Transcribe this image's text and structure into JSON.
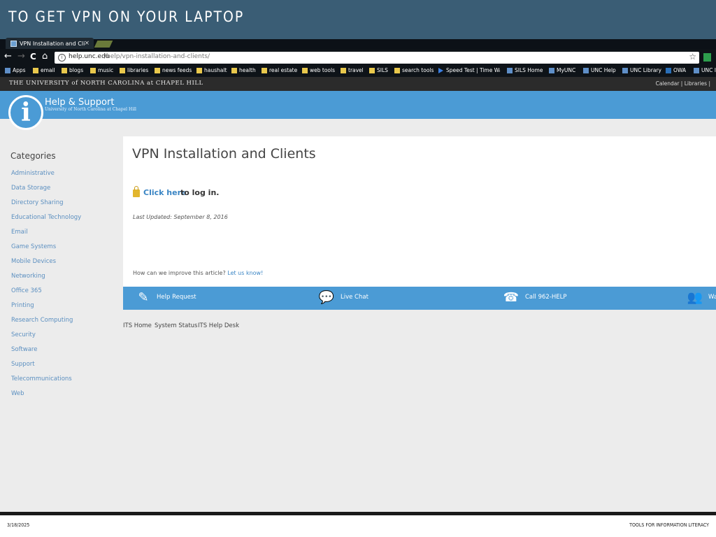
{
  "slide": {
    "title": "TO GET VPN ON YOUR LAPTOP",
    "date": "3/18/2025",
    "footer": "TOOLS FOR INFORMATION LITERACY"
  },
  "browser": {
    "tab_title": "VPN Installation and Cli",
    "tab_close": "×",
    "back_icon": "←",
    "forward_icon": "→",
    "reload_icon": "C",
    "home_icon": "⌂",
    "url_host": "help.unc.edu",
    "url_path": "/help/vpn-installation-and-clients/",
    "star_icon": "☆",
    "bookmarks": [
      "Apps",
      "email",
      "blogs",
      "music",
      "libraries",
      "news feeds",
      "haushalt",
      "health",
      "real estate",
      "web tools",
      "travel",
      "SILS",
      "search tools",
      "Speed Test | Time Wa",
      "SILS Home",
      "MyUNC",
      "UNC Help",
      "UNC Library",
      "OWA",
      "UNC I"
    ]
  },
  "site": {
    "university": "THE UNIVERSITY of NORTH CAROLINA at CHAPEL HILL",
    "top_links": "Calendar  |  Libraries  |",
    "logo_letter": "i",
    "help_title": "Help & Support",
    "help_subtitle": "University of North Carolina at Chapel Hill"
  },
  "sidebar": {
    "heading": "Categories",
    "items": [
      "Administrative",
      "Data Storage",
      "Directory Sharing",
      "Educational Technology",
      "Email",
      "Game Systems",
      "Mobile Devices",
      "Networking",
      "Office 365",
      "Printing",
      "Research Computing",
      "Security",
      "Software",
      "Support",
      "Telecommunications",
      "Web"
    ]
  },
  "article": {
    "title": "VPN Installation and Clients",
    "login_link": "Click here",
    "login_rest": "to log in.",
    "updated": "Last Updated: September 8, 2016",
    "improve_text": "How can we improve this article?",
    "improve_link": "Let us know!"
  },
  "actions": {
    "help_request": "Help Request",
    "live_chat": "Live Chat",
    "call": "Call 962-HELP",
    "walk_in": "Wa"
  },
  "footer_links": [
    "ITS Home",
    "System Status",
    "ITS Help Desk"
  ],
  "colors": {
    "slide_header": "#3a5d75",
    "unc_blue": "#4b9bd5",
    "link": "#3a85c4"
  }
}
